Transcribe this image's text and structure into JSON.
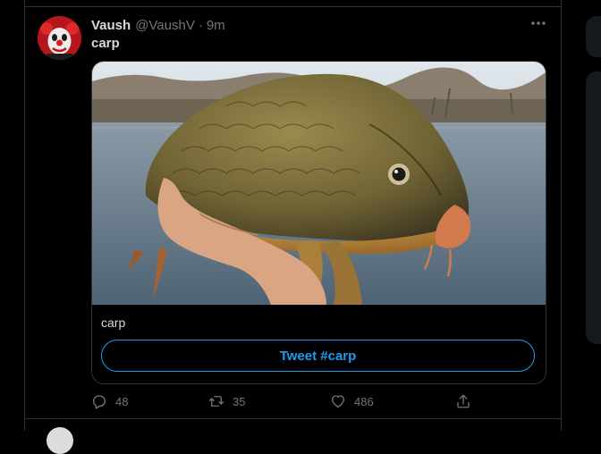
{
  "tweet": {
    "display_name": "Vaush",
    "handle": "@VaushV",
    "separator": "·",
    "time": "9m",
    "text": "carp"
  },
  "card": {
    "caption": "carp",
    "button_label": "Tweet #carp"
  },
  "actions": {
    "reply_count": "48",
    "retweet_count": "35",
    "like_count": "486"
  },
  "colors": {
    "accent": "#1d9bf0",
    "muted": "#6e767d",
    "border": "#2f3336",
    "text": "#d9d9d9"
  },
  "icons": [
    "avatar-clown",
    "more-icon",
    "reply-icon",
    "retweet-icon",
    "like-icon",
    "share-icon"
  ]
}
